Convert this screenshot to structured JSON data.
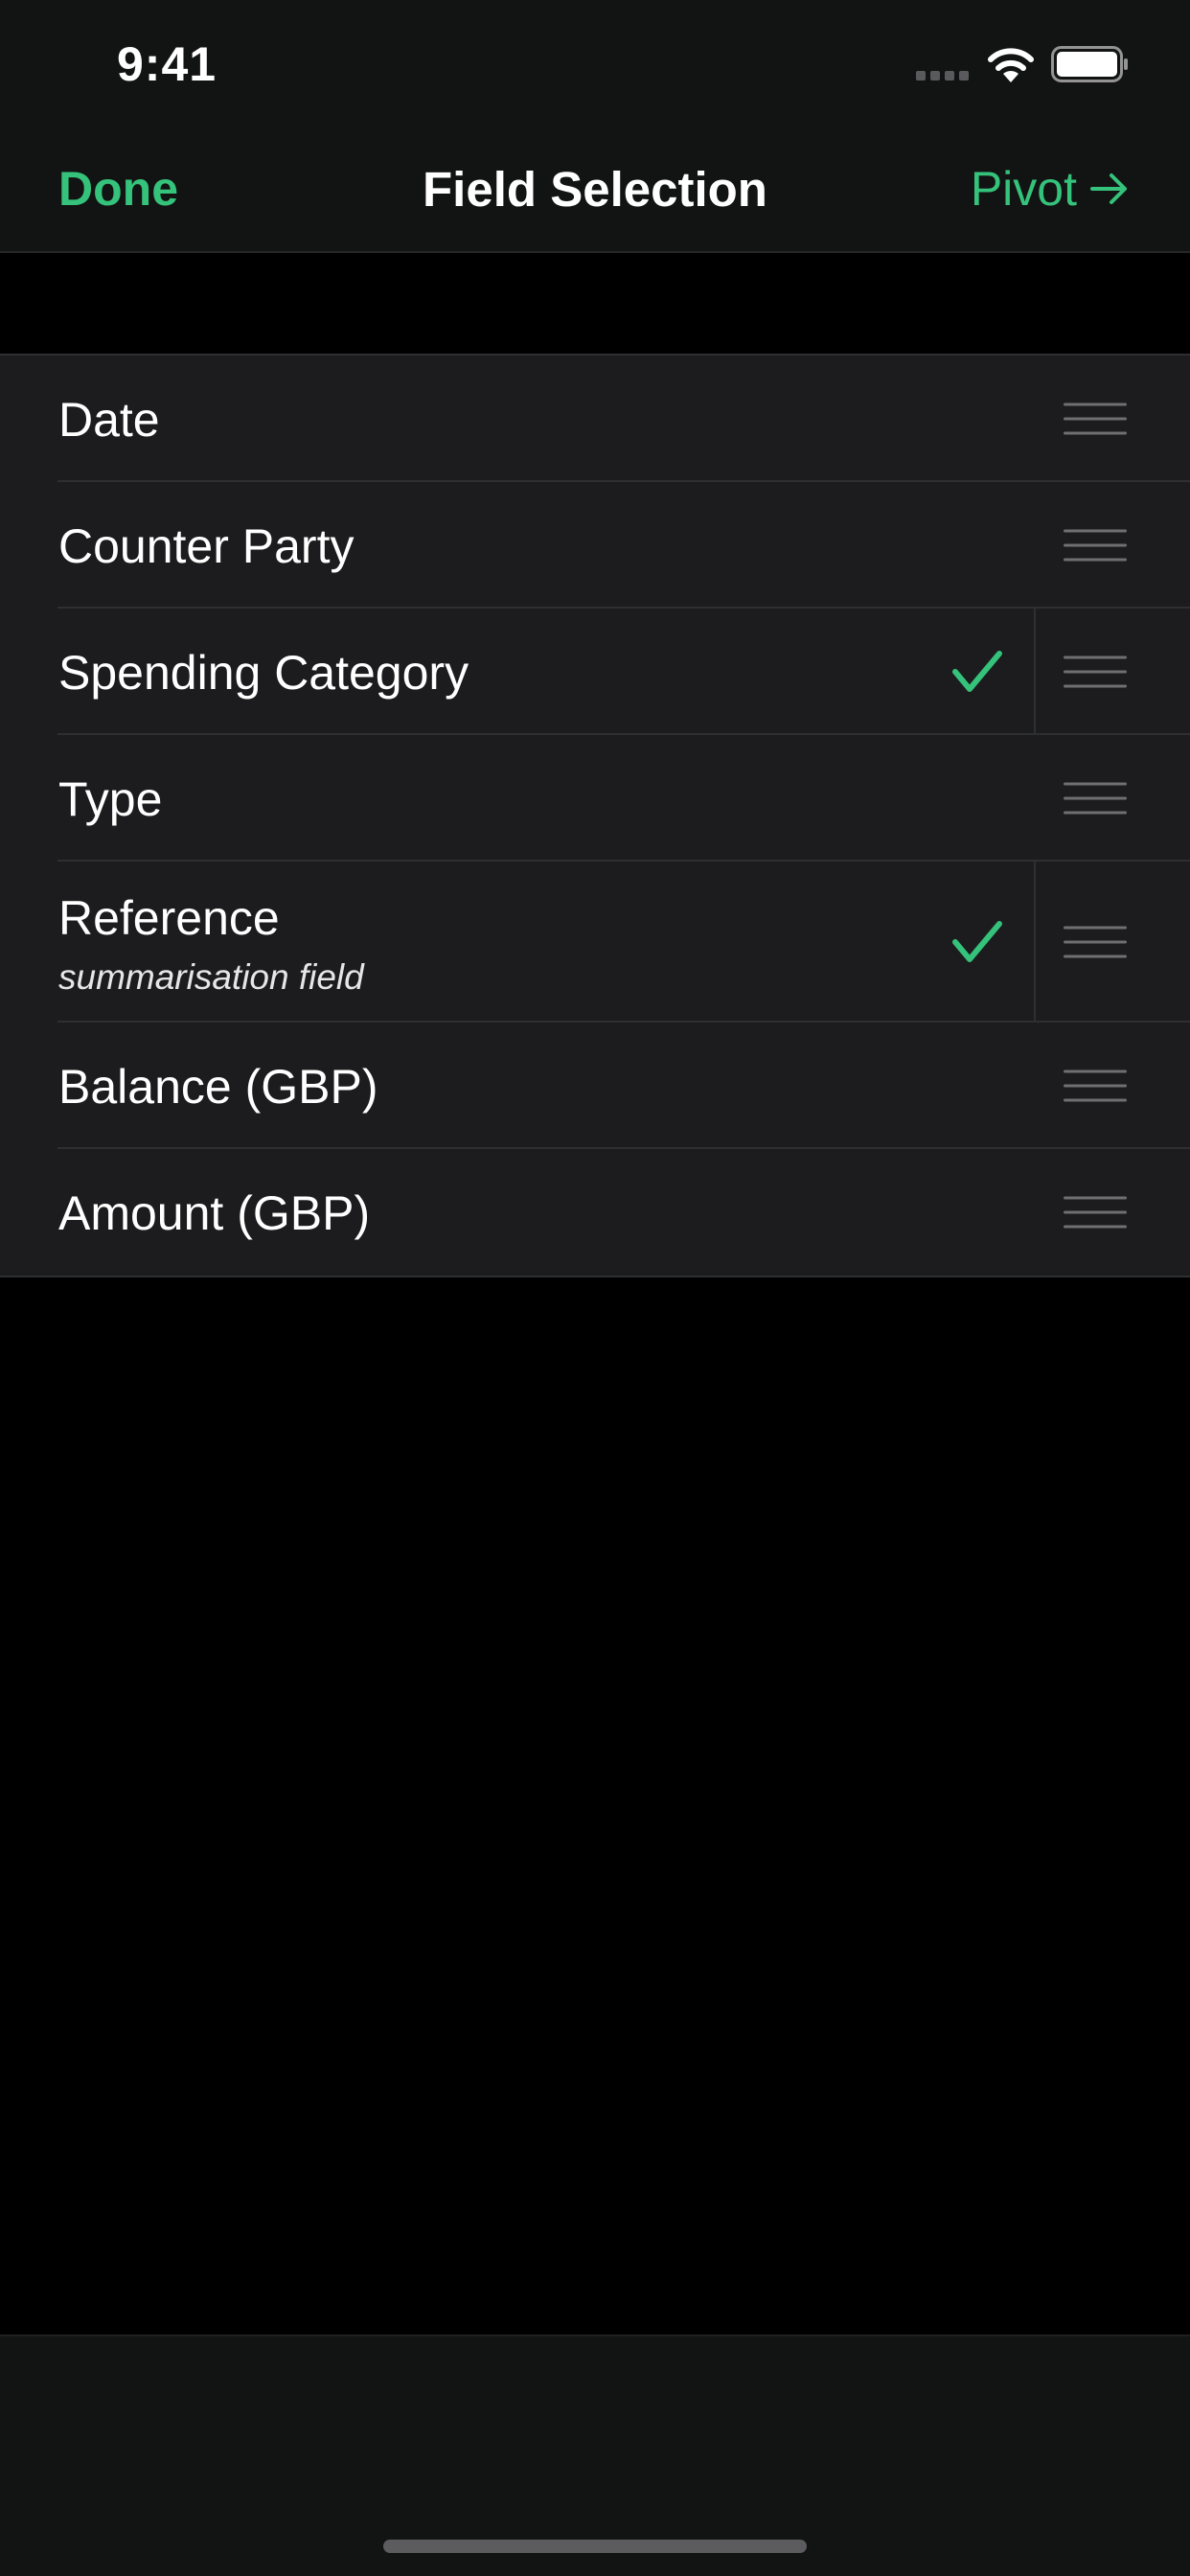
{
  "status_bar": {
    "time": "9:41",
    "icons": [
      "signal-icon",
      "wifi-icon",
      "battery-icon"
    ]
  },
  "nav": {
    "done_label": "Done",
    "title": "Field Selection",
    "pivot_label": "Pivot",
    "pivot_icon": "arrow-right-icon"
  },
  "fields": [
    {
      "label": "Date",
      "subtitle": "",
      "checked": false
    },
    {
      "label": "Counter Party",
      "subtitle": "",
      "checked": false
    },
    {
      "label": "Spending Category",
      "subtitle": "",
      "checked": true
    },
    {
      "label": "Type",
      "subtitle": "",
      "checked": false
    },
    {
      "label": "Reference",
      "subtitle": "summarisation field",
      "checked": true
    },
    {
      "label": "Balance (GBP)",
      "subtitle": "",
      "checked": false
    },
    {
      "label": "Amount (GBP)",
      "subtitle": "",
      "checked": false
    }
  ],
  "colors": {
    "accent": "#35c27b",
    "bar_background": "#121313",
    "cell_background": "#1c1c1e",
    "page_background": "#000000",
    "separator": "#2e2f31"
  }
}
